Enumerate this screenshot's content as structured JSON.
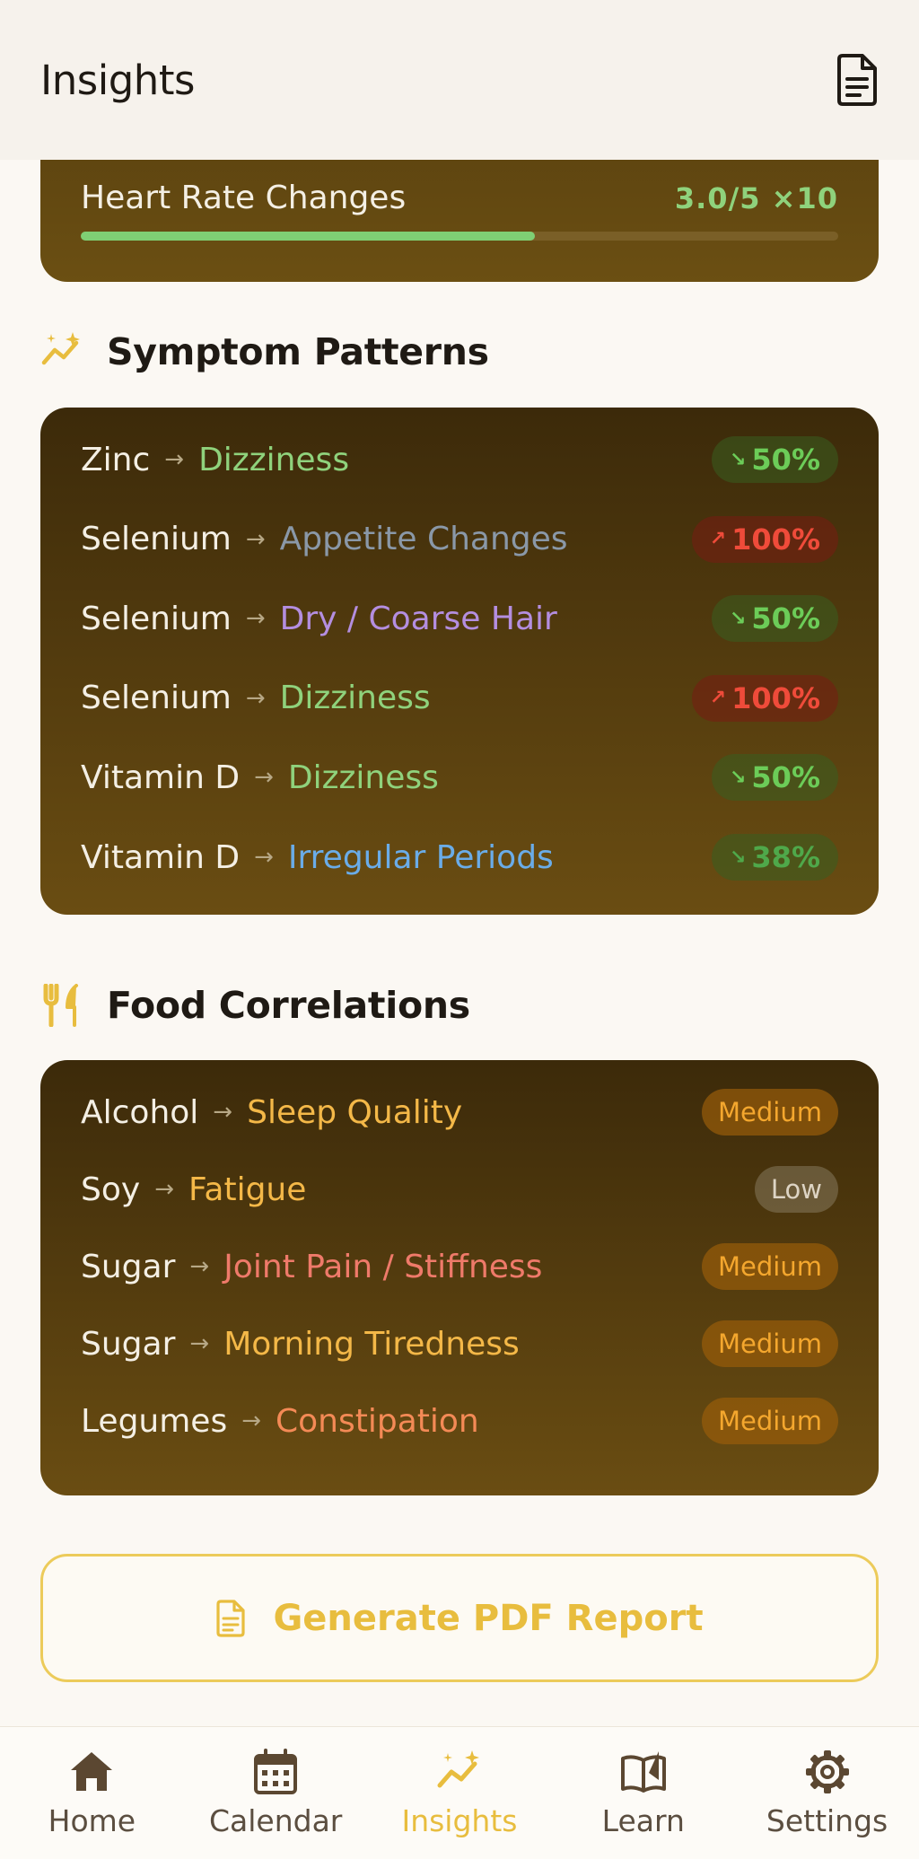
{
  "header": {
    "title": "Insights",
    "report_icon": "document-icon"
  },
  "heart_rate": {
    "label": "Heart Rate Changes",
    "value": "3.0/5 ×10",
    "fill": 0.6
  },
  "symptoms": {
    "title": "Symptom Patterns",
    "icon": "sparkle-trend-icon",
    "rows": [
      {
        "source": "Zinc",
        "target": "Dizziness",
        "target_color": "#8fd27c",
        "pct": "50%",
        "trend": "down"
      },
      {
        "source": "Selenium",
        "target": "Appetite Changes",
        "target_color": "#8a98a8",
        "pct": "100%",
        "trend": "up"
      },
      {
        "source": "Selenium",
        "target": "Dry / Coarse Hair",
        "target_color": "#b48ee0",
        "pct": "50%",
        "trend": "down"
      },
      {
        "source": "Selenium",
        "target": "Dizziness",
        "target_color": "#8fd27c",
        "pct": "100%",
        "trend": "up"
      },
      {
        "source": "Vitamin D",
        "target": "Dizziness",
        "target_color": "#8fd27c",
        "pct": "50%",
        "trend": "down"
      },
      {
        "source": "Vitamin D",
        "target": "Irregular Periods",
        "target_color": "#6aace8",
        "pct": "38%",
        "trend": "down"
      }
    ]
  },
  "food": {
    "title": "Food Correlations",
    "icon": "fork-knife-icon",
    "rows": [
      {
        "source": "Alcohol",
        "target": "Sleep Quality",
        "target_color": "#f4b848",
        "level": "Medium"
      },
      {
        "source": "Soy",
        "target": "Fatigue",
        "target_color": "#f4b848",
        "level": "Low"
      },
      {
        "source": "Sugar",
        "target": "Joint Pain / Stiffness",
        "target_color": "#ef7a6a",
        "level": "Medium"
      },
      {
        "source": "Sugar",
        "target": "Morning Tiredness",
        "target_color": "#f4b848",
        "level": "Medium"
      },
      {
        "source": "Legumes",
        "target": "Constipation",
        "target_color": "#f48a56",
        "level": "Medium"
      }
    ]
  },
  "pdf_button": {
    "label": "Generate PDF Report"
  },
  "tabs": [
    {
      "label": "Home",
      "icon": "home-icon"
    },
    {
      "label": "Calendar",
      "icon": "calendar-icon"
    },
    {
      "label": "Insights",
      "icon": "insights-icon",
      "active": true
    },
    {
      "label": "Learn",
      "icon": "book-icon"
    },
    {
      "label": "Settings",
      "icon": "gear-icon"
    }
  ],
  "colors": {
    "accent": "#e8bd3e",
    "card": "#5c4310",
    "background": "#fbf8f3"
  }
}
